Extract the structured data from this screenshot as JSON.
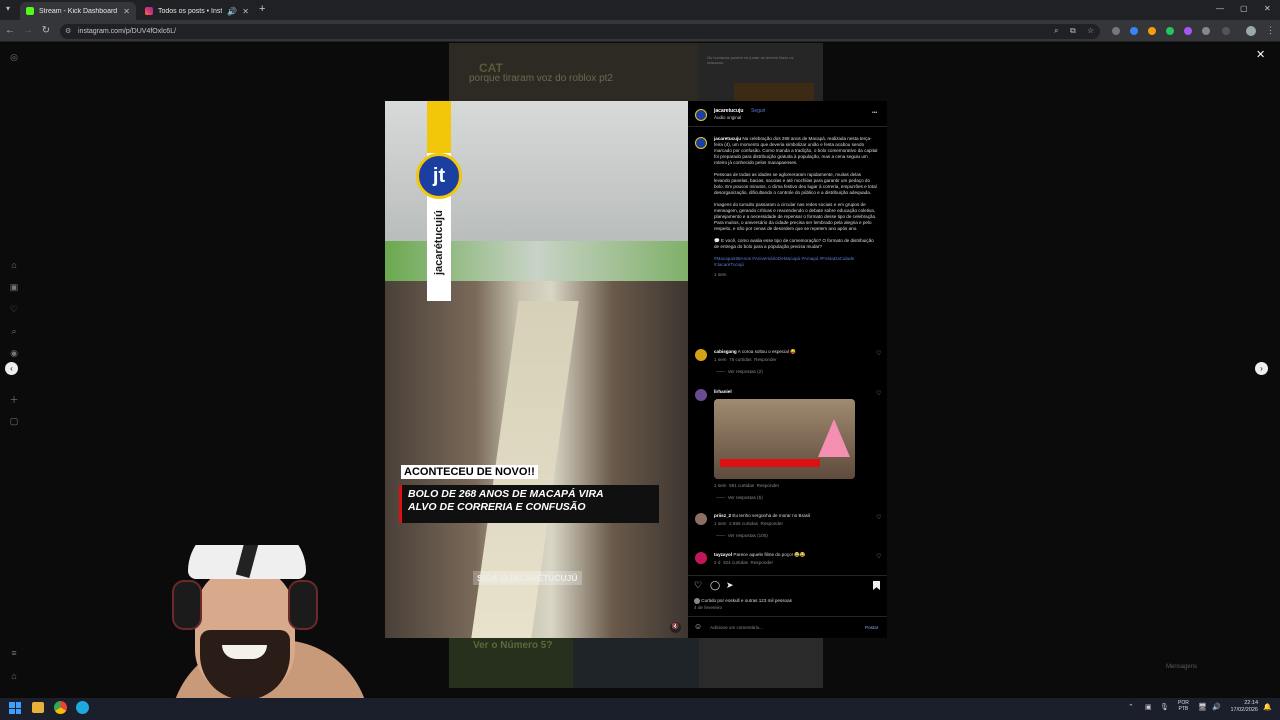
{
  "browser": {
    "tabs": [
      {
        "title": "Stream - Kick Dashboard",
        "favicon_color": "#53fc18",
        "active": true
      },
      {
        "title": "Todos os posts • Instagram",
        "favicon_color": "#e1306c",
        "active": false
      }
    ],
    "url": "instagram.com/p/DUV4fOxlc6L/",
    "new_tab": "+",
    "window_controls": [
      "—",
      "▢",
      "✕"
    ]
  },
  "background": {
    "thumb1_text": "porque tiraram voz do roblox pt2",
    "thumb1_logo": "CAT",
    "thumb2_text": "Ver o Número 5?",
    "top_right_text": "Os humanos podem se juntar ao devem fazer os macacos.",
    "messages_label": "Mensagens"
  },
  "post": {
    "brand_letters": "jt",
    "brand_vertical": "jacarétucujú",
    "headline1": "ACONTECEU DE NOVO!!",
    "headline2a": "BOLO DE 268 ANOS DE MACAPÁ VIRA",
    "headline2b": "ALVO DE CORRERIA E CONFUSÃO",
    "watermark": "SIGA @JACARÉTUCUJÚ",
    "mute_icon": "speaker-off"
  },
  "panel": {
    "username": "jacaretucuju",
    "follow": "Seguir",
    "audio": "Áudio original",
    "more": "•••",
    "caption_user": "jacaretucuju",
    "caption_p1": "Na celebração dos 268 anos de Macapá, realizada nesta terça-feira (4), um momento que deveria simbolizar união e festa acabou sendo marcado por confusão. Como manda a tradição, o bolo comemorativo da capital foi preparado para distribuição gratuita à população, mas a cena seguiu um roteiro já conhecido pelos macapaenses.",
    "caption_p2": "Pessoas de todas as idades se aglomeraram rapidamente, muitas delas levando panelas, bacias, sacolas e até mochilas para garantir um pedaço do bolo. Em poucos minutos, o clima festivo deu lugar à correria, empurrões e total desorganização, dificultando o controle do público e a distribuição adequada.",
    "caption_p3": "Imagens do tumulto passaram a circular nas redes sociais e em grupos de mensagem, gerando críticas e reacendendo o debate sobre educação coletiva, planejamento e a necessidade de repensar o formato desse tipo de celebração. Para muitos, o aniversário da cidade precisa ser lembrado pela alegria e pelo respeito, e não por cenas de desordem que se repetem ano após ano.",
    "caption_p4": "💬 E você, como avalia esse tipo de comemoração? O formato de distribuição de entrega do bolo para a população precisa mudar?",
    "hashtags": "#Macapa268Anos #AniversárioDeMacapá #Amapá #FestaDaCidade #JacaréTucujú",
    "caption_time": "1 sem",
    "comments": [
      {
        "user": "cabisgang",
        "text": "A coroa soltou o especial 😝",
        "meta_time": "1 sem",
        "meta_likes": "76 curtidas",
        "reply": "Responder",
        "view": "Ver respostas (2)",
        "avatar": "#d4a017"
      },
      {
        "user": "lirhaniel",
        "text": "",
        "meta_time": "1 sem",
        "meta_likes": "591 curtidas",
        "reply": "Responder",
        "view": "Ver respostas (5)",
        "avatar": "#6a4c93"
      },
      {
        "user": "priisz_2",
        "text": "Eu tenho vergonha de morar no Brasil",
        "meta_time": "1 sem",
        "meta_likes": "2.856 curtidas",
        "reply": "Responder",
        "view": "Ver respostas (100)",
        "avatar": "#8d6e63"
      },
      {
        "user": "tayzayol",
        "text": "Parece aquele filme do poço! 😂😂",
        "meta_time": "2 d",
        "meta_likes": "324 curtidas",
        "reply": "Responder",
        "view": "",
        "avatar": "#c2185b"
      }
    ],
    "liked_by": "Curtido por eoskull e outras 123 mil pessoas",
    "date": "4 de fevereiro",
    "add_comment_placeholder": "Adicione um comentário...",
    "post_button": "Postar"
  },
  "taskbar": {
    "lang": "POR",
    "lang2": "PTB",
    "time": "22:14",
    "date": "17/02/2026"
  },
  "colors": {
    "ig_blue": "#4f7cff",
    "kick_green": "#53fc18",
    "headline_bg": "#000000",
    "taskbar": "#1a1f2b"
  }
}
